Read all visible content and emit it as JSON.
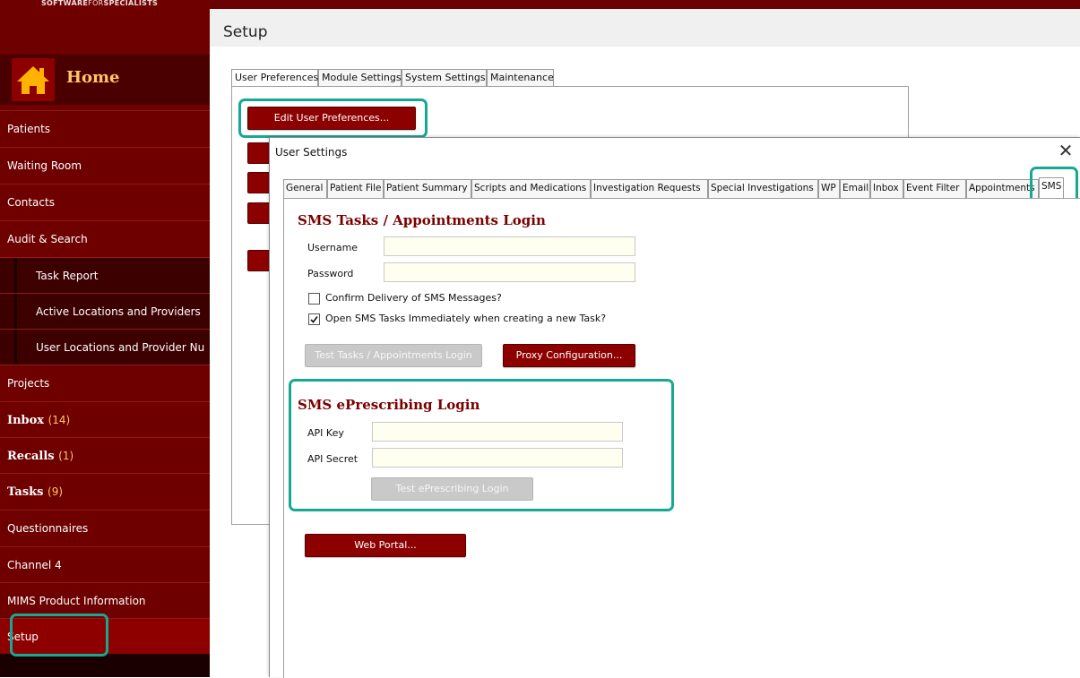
{
  "app": {
    "logo_bold": "SOFTWARE",
    "logo_thin": "FOR",
    "logo_bold2": "SPECIALISTS"
  },
  "sidebar": {
    "home_label": "Home",
    "items": [
      {
        "label": "Patients"
      },
      {
        "label": "Waiting Room"
      },
      {
        "label": "Contacts"
      },
      {
        "label": "Audit & Search"
      },
      {
        "label": "Task Report"
      },
      {
        "label": "Active Locations and Providers"
      },
      {
        "label": "User Locations and  Provider Nu"
      },
      {
        "label": "Projects"
      },
      {
        "label": "Inbox",
        "count": "(14)"
      },
      {
        "label": "Recalls",
        "count": "(1)"
      },
      {
        "label": "Tasks",
        "count": "(9)"
      },
      {
        "label": "Questionnaires"
      },
      {
        "label": "Channel 4"
      },
      {
        "label": "MIMS Product Information"
      },
      {
        "label": "Setup"
      }
    ]
  },
  "main": {
    "title": "Setup",
    "tabs": [
      "User Preferences",
      "Module Settings",
      "System Settings",
      "Maintenance"
    ],
    "edit_prefs_button": "Edit User Preferences..."
  },
  "dialog": {
    "title": "User Settings",
    "close_glyph": "✕",
    "tabs": [
      "General",
      "Patient File",
      "Patient Summary",
      "Scripts and Medications",
      "Investigation Requests",
      "Special Investigations",
      "WP",
      "Email",
      "Inbox",
      "Event Filter",
      "Appointments",
      "SMS"
    ],
    "sms_login": {
      "title": "SMS Tasks / Appointments Login",
      "username_label": "Username",
      "username_value": "",
      "password_label": "Password",
      "password_value": "",
      "confirm_delivery_label": "Confirm Delivery of SMS Messages?",
      "confirm_delivery_checked": false,
      "open_tasks_label": "Open SMS Tasks Immediately when creating a new Task?",
      "open_tasks_checked": true,
      "test_login_button": "Test Tasks / Appointments Login",
      "proxy_button": "Proxy Configuration..."
    },
    "eprescribing": {
      "title": "SMS ePrescribing Login",
      "api_key_label": "API Key",
      "api_key_value": "",
      "api_secret_label": "API Secret",
      "api_secret_value": "",
      "test_button": "Test ePrescribing Login"
    },
    "web_portal_button": "Web Portal..."
  },
  "colors": {
    "brand_dark_red": "#6e0000",
    "button_red": "#8c0000",
    "highlight_teal": "#17a894",
    "accent_gold": "#ffc766",
    "input_bg": "#fffff0"
  }
}
